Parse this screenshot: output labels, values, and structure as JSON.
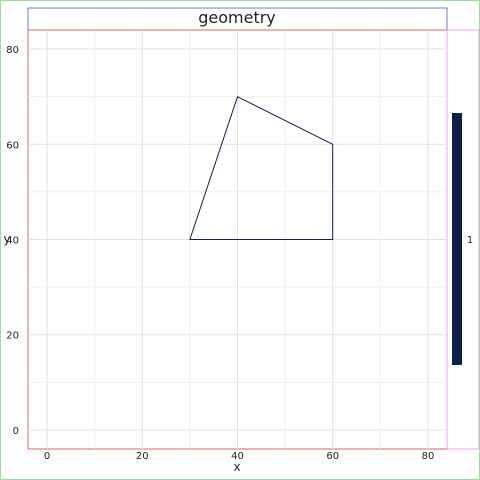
{
  "chart_data": {
    "type": "polygon",
    "title": "geometry",
    "xlabel": "x",
    "ylabel": "y",
    "xlim": [
      -4,
      84
    ],
    "ylim": [
      -4,
      84
    ],
    "xticks": [
      0,
      20,
      40,
      60,
      80
    ],
    "yticks": [
      0,
      20,
      40,
      60,
      80
    ],
    "grid": true,
    "polygon": {
      "vertices": [
        [
          30,
          40
        ],
        [
          40,
          70
        ],
        [
          60,
          60
        ],
        [
          60,
          40
        ]
      ],
      "stroke": "#0b2455",
      "fill": "none"
    },
    "colorbar": {
      "label": "1",
      "color": "#0b1f4a"
    }
  }
}
